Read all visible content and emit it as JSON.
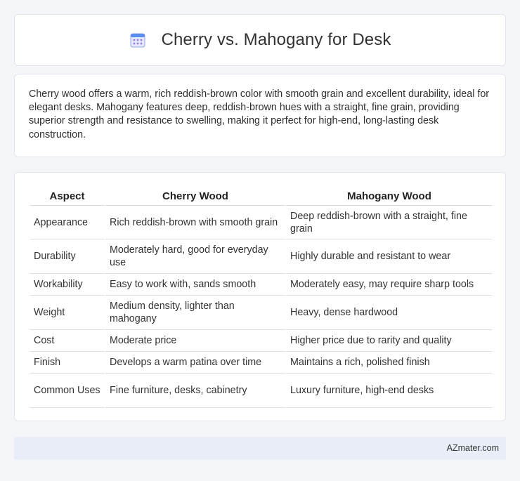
{
  "header": {
    "title": "Cherry vs. Mahogany for Desk",
    "icon": "calendar-icon"
  },
  "summary": {
    "text": "Cherry wood offers a warm, rich reddish-brown color with smooth grain and excellent durability, ideal for elegant desks. Mahogany features deep, reddish-brown hues with a straight, fine grain, providing superior strength and resistance to swelling, making it perfect for high-end, long-lasting desk construction."
  },
  "table": {
    "headers": [
      "Aspect",
      "Cherry Wood",
      "Mahogany Wood"
    ],
    "rows": [
      [
        "Appearance",
        "Rich reddish-brown with smooth grain",
        "Deep reddish-brown with a straight, fine grain"
      ],
      [
        "Durability",
        "Moderately hard, good for everyday use",
        "Highly durable and resistant to wear"
      ],
      [
        "Workability",
        "Easy to work with, sands smooth",
        "Moderately easy, may require sharp tools"
      ],
      [
        "Weight",
        "Medium density, lighter than mahogany",
        "Heavy, dense hardwood"
      ],
      [
        "Cost",
        "Moderate price",
        "Higher price due to rarity and quality"
      ],
      [
        "Finish",
        "Develops a warm patina over time",
        "Maintains a rich, polished finish"
      ],
      [
        "Common Uses",
        "Fine furniture, desks, cabinetry",
        "Luxury furniture, high-end desks"
      ]
    ]
  },
  "footer": {
    "brand": "AZmater.com"
  },
  "colors": {
    "background": "#f4f5f9",
    "card": "#ffffff",
    "footer_bar": "#e9edf7",
    "icon_blue": "#5b8def",
    "icon_purple": "#9b7be0"
  }
}
